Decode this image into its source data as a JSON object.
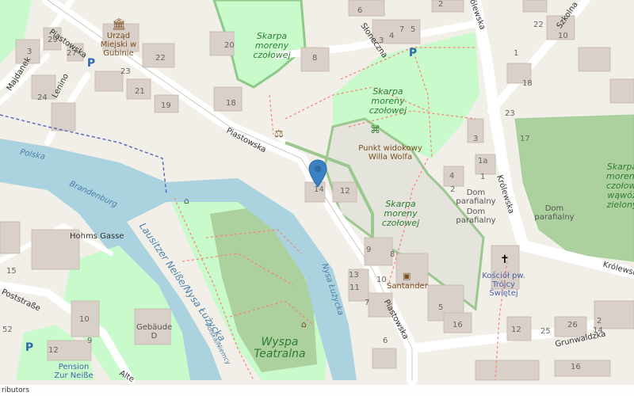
{
  "map": {
    "attribution": "ributors",
    "streets": {
      "piastowska_1": "Piastowska",
      "piastowska_2": "Piastowska",
      "piastowska_3": "Piastowska",
      "majdanek": "Majdanek",
      "lenino": "Lenino",
      "sloneczna": "Słoneczna",
      "szkolna": "Szkolna",
      "krolewska_1": "Królewska",
      "krolewska_2": "Królewska",
      "krolewska_3": "Królewska",
      "grunwaldzka": "Grunwaldzka",
      "hohms_gasse": "Hohms Gasse",
      "poststrasse": "Poststraße",
      "alte": "Alte",
      "nysa": "Nysa Łużycka",
      "polska": "Polska",
      "brandenburg": "Brandenburg",
      "lausitzer": "Lausitzer Neiße/Nysa Łużycka",
      "granica": "Polska/Niemcy"
    },
    "parks": {
      "skarpa_nw": "Skarpa moreny czołowej",
      "skarpa_center": "Skarpa moreny czołowej",
      "skarpa_south": "Skarpa moreny czołowej",
      "skarpa_east": "Skarpa moreny czołowej wąwóz zielony",
      "wyspa": "Wyspa Teatralna"
    },
    "pois": {
      "urzad": "Urząd Miejski w Gubinie",
      "punkt": "Punkt widokowy Willa Wolfa",
      "dom1": "Dom parafialny",
      "dom2": "Dom parafialny",
      "dom3": "Dom parafialny",
      "kosciol": "Kościół pw. Trójcy Świętej",
      "santander": "Santander",
      "pension": "Pension Zur Neiße",
      "gebaude": "Gebäude D"
    },
    "house_numbers": [
      "20",
      "29",
      "27",
      "3",
      "24",
      "23",
      "21",
      "18",
      "19",
      "22",
      "8",
      "6",
      "5",
      "7",
      "4",
      "3",
      "2",
      "1",
      "10",
      "14",
      "12",
      "13",
      "11",
      "10",
      "9",
      "8",
      "7",
      "6",
      "5",
      "4",
      "3",
      "1a",
      "1",
      "2",
      "16",
      "17",
      "18",
      "22",
      "23",
      "12",
      "26",
      "25",
      "14",
      "16",
      "10",
      "15",
      "52",
      "9",
      "12",
      "2"
    ],
    "pin_color": "#3b82c4",
    "colors": {
      "background": "#f2efe9",
      "building": "#d9d0c9",
      "park": "#c8facc",
      "wood": "#add19e",
      "water": "#aad3df",
      "road": "#ffffff",
      "path": "#fa8072"
    }
  }
}
